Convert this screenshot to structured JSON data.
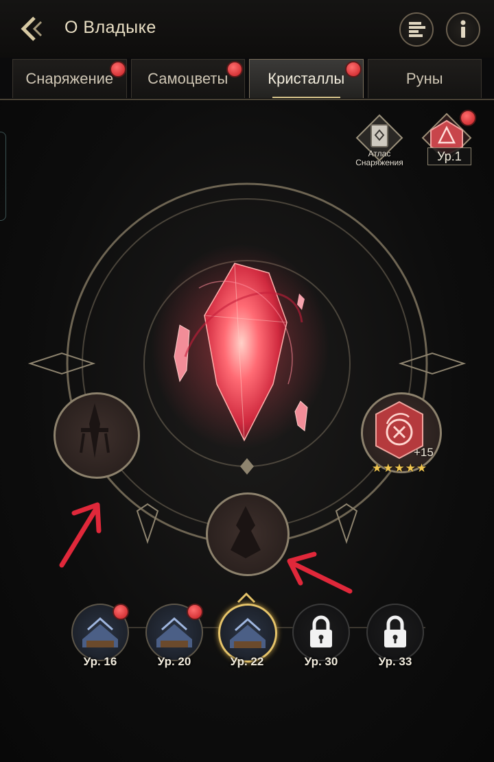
{
  "header": {
    "title": "О Владыке",
    "back_icon": "chevron-left-icon",
    "ranking_icon": "ranking-bars-icon",
    "info_icon": "info-icon"
  },
  "tabs": [
    {
      "label": "Снаряжение",
      "badge": true,
      "active": false
    },
    {
      "label": "Самоцветы",
      "badge": true,
      "active": false
    },
    {
      "label": "Кристаллы",
      "badge": true,
      "active": true
    },
    {
      "label": "Руны",
      "badge": false,
      "active": false
    }
  ],
  "top_right": {
    "atlas_label": "Атлас Снаряжения",
    "level_label": "Ур.1",
    "level_badge": true
  },
  "crystal_slots": {
    "left_icon": "dagger-icon",
    "bottom_icon": "flame-rune-icon",
    "right_icon": "fire-emblem-icon",
    "right_enhance": "+15",
    "right_stars": 5
  },
  "levels": [
    {
      "label": "Ур. 16",
      "locked": false,
      "badge": true,
      "active": false
    },
    {
      "label": "Ур. 20",
      "locked": false,
      "badge": true,
      "active": false
    },
    {
      "label": "Ур. 22",
      "locked": false,
      "badge": false,
      "active": true
    },
    {
      "label": "Ур. 30",
      "locked": true,
      "badge": false,
      "active": false
    },
    {
      "label": "Ур. 33",
      "locked": true,
      "badge": false,
      "active": false
    }
  ],
  "colors": {
    "accent_gold": "#d9c58c",
    "badge_red": "#d42a2f",
    "crystal_red": "#ff4b5c",
    "annotation_arrow": "#e0283a"
  }
}
